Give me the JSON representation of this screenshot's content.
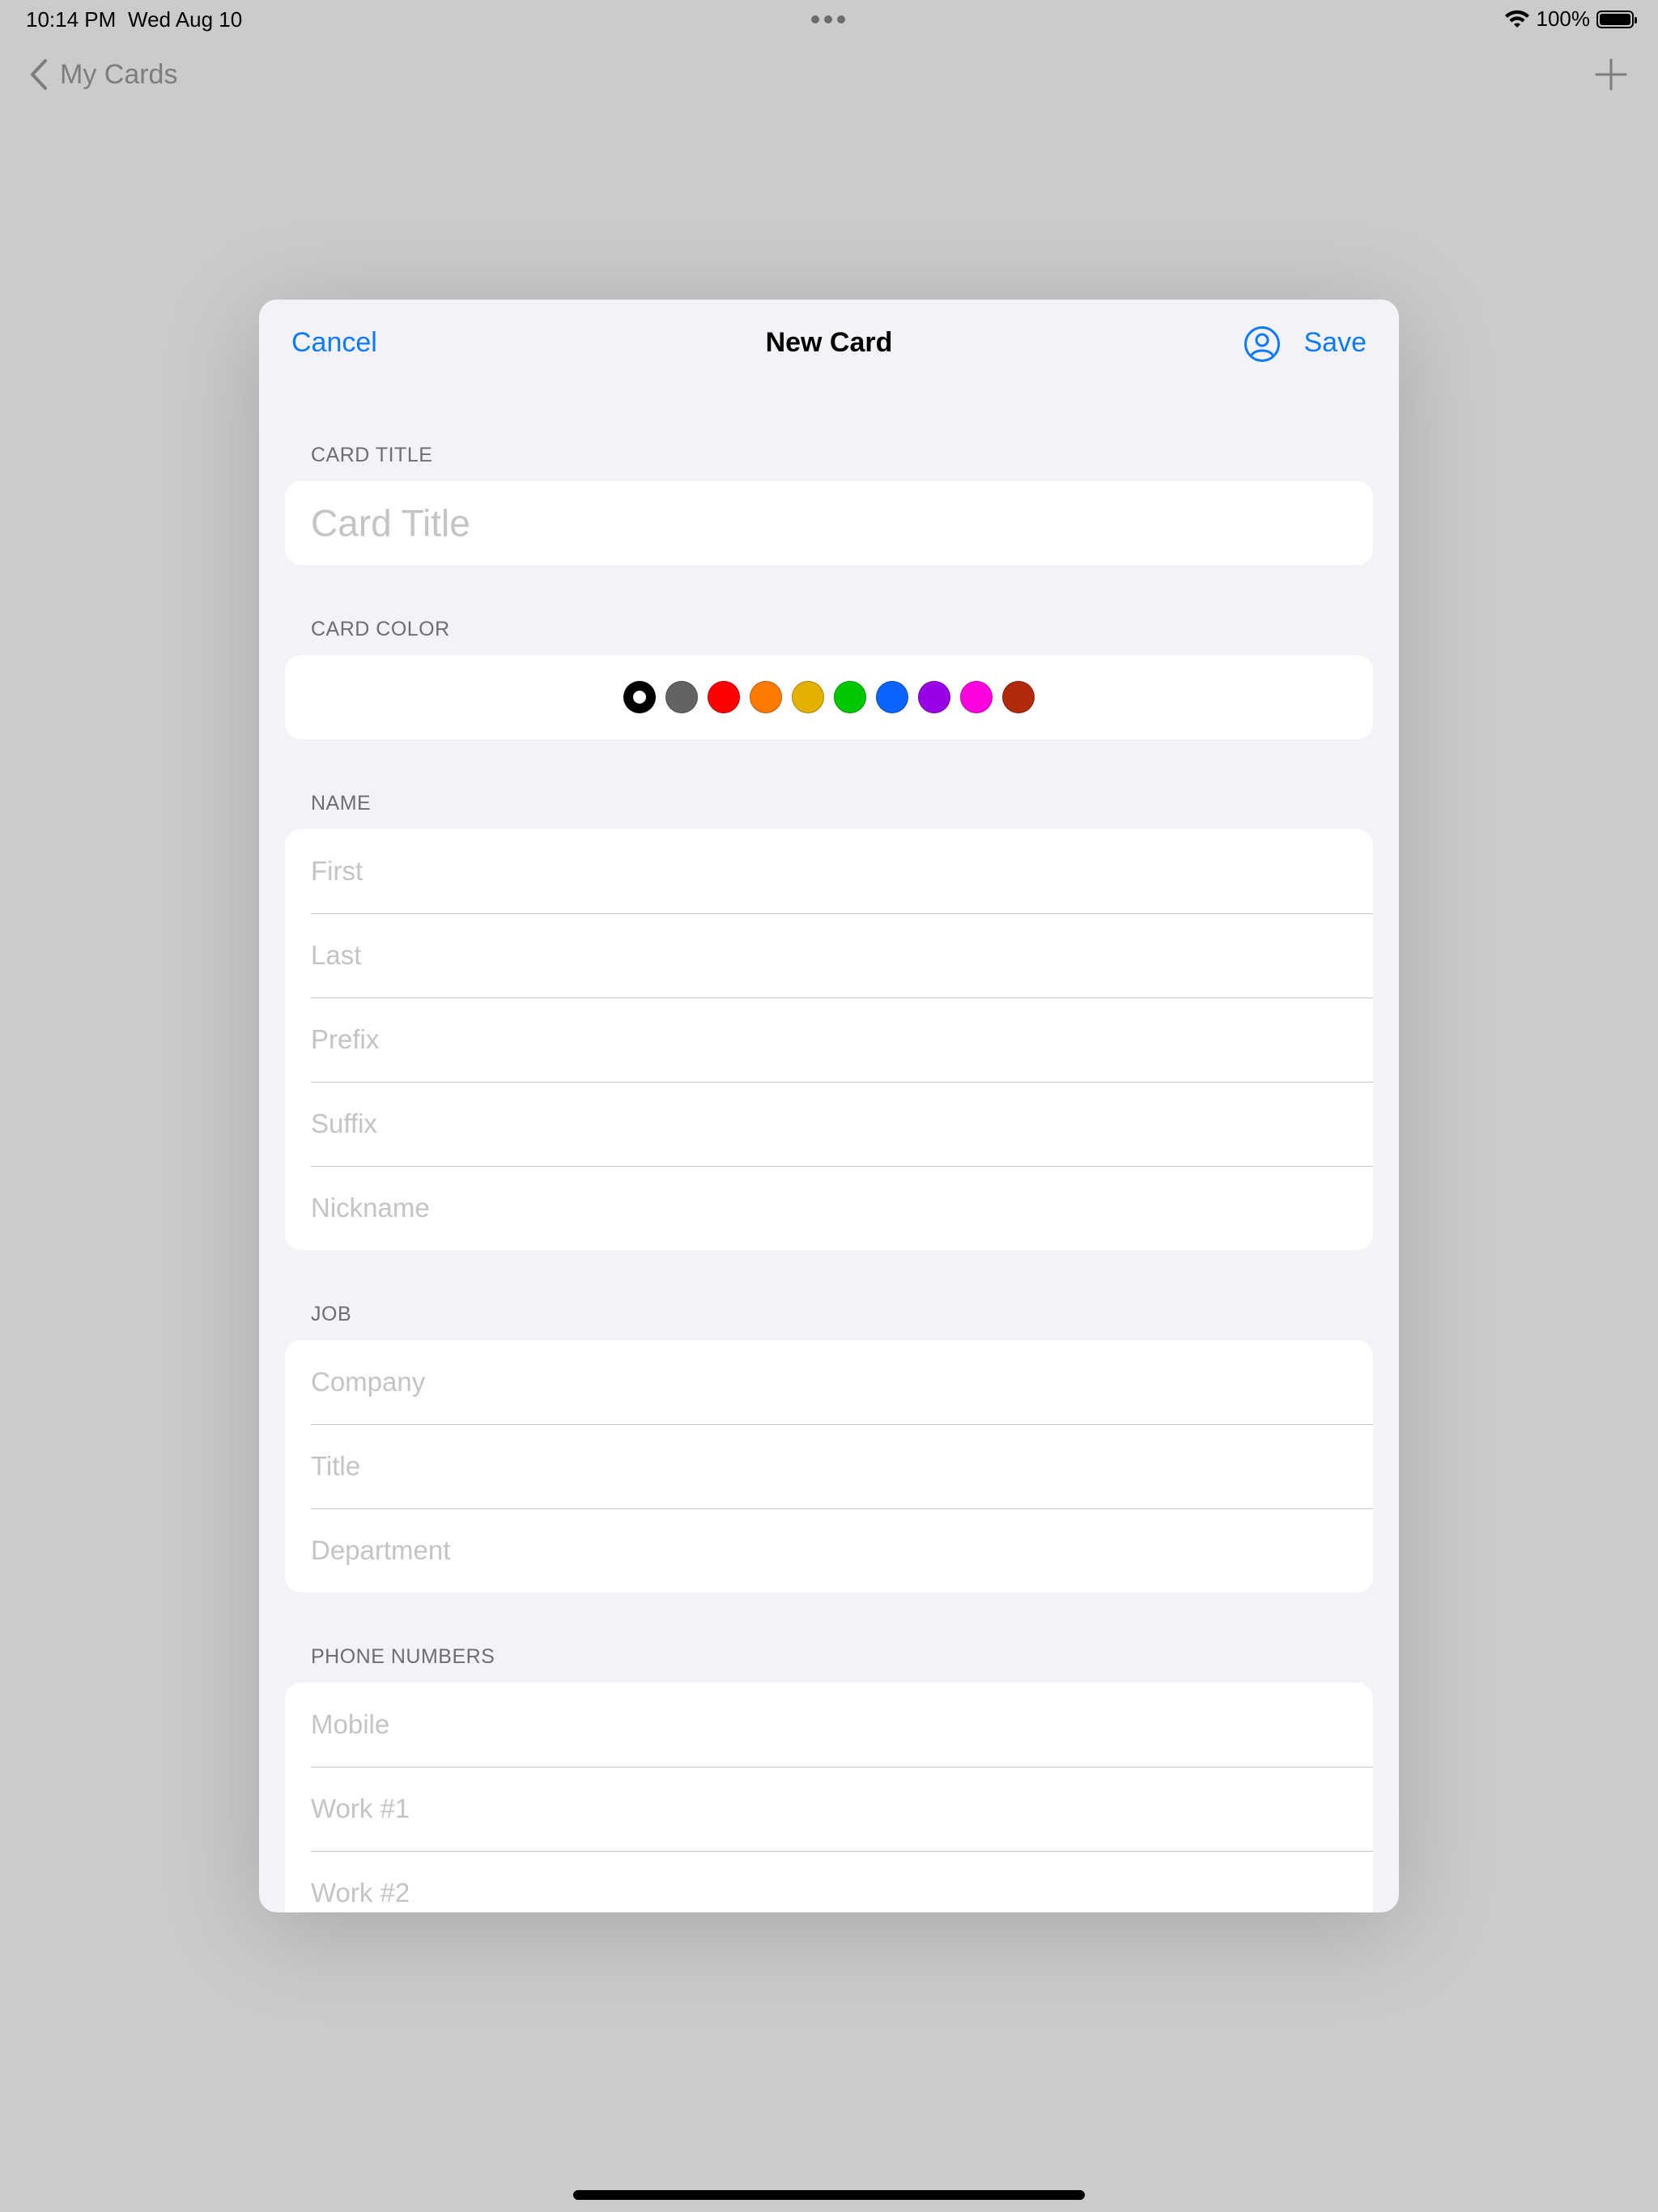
{
  "status_bar": {
    "time": "10:14 PM",
    "date": "Wed Aug 10",
    "battery": "100%"
  },
  "background_nav": {
    "back_label": "My Cards"
  },
  "sheet": {
    "cancel_label": "Cancel",
    "title": "New Card",
    "save_label": "Save"
  },
  "sections": {
    "card_title": {
      "label": "CARD TITLE",
      "placeholder": "Card Title"
    },
    "card_color": {
      "label": "CARD COLOR",
      "selected_index": 0,
      "colors": [
        "#000000",
        "#636366",
        "#ff0000",
        "#ff7a00",
        "#e5b100",
        "#00c800",
        "#0a64ff",
        "#9a00e6",
        "#ff00e0",
        "#b12a0c"
      ]
    },
    "name": {
      "label": "NAME",
      "fields": [
        "First",
        "Last",
        "Prefix",
        "Suffix",
        "Nickname"
      ]
    },
    "job": {
      "label": "JOB",
      "fields": [
        "Company",
        "Title",
        "Department"
      ]
    },
    "phone_numbers": {
      "label": "PHONE NUMBERS",
      "fields": [
        "Mobile",
        "Work #1",
        "Work #2"
      ]
    }
  },
  "colors": {
    "accent": "#0a7aff",
    "sheet_bg": "#f2f2f7",
    "dim_bg": "#cbcbcb"
  }
}
